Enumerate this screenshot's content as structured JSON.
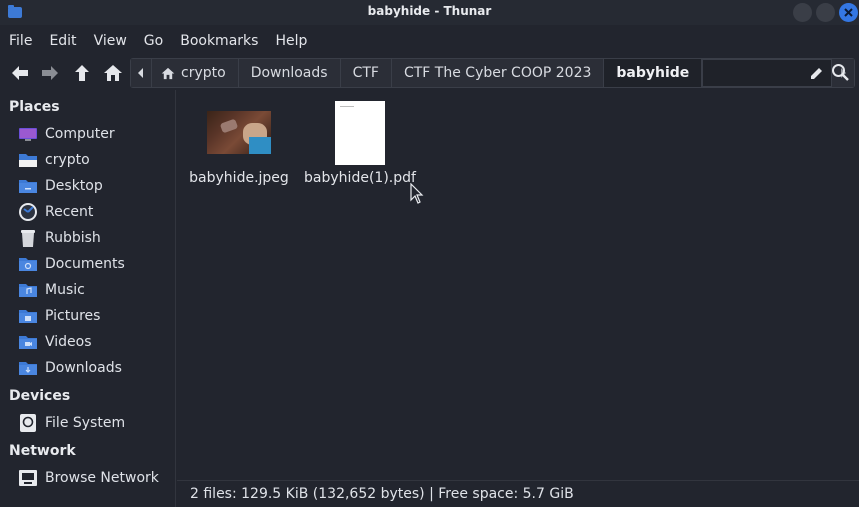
{
  "window": {
    "title": "babyhide - Thunar"
  },
  "menu": [
    "File",
    "Edit",
    "View",
    "Go",
    "Bookmarks",
    "Help"
  ],
  "breadcrumbs": [
    "crypto",
    "Downloads",
    "CTF",
    "CTF The Cyber COOP 2023",
    "babyhide"
  ],
  "sidebar": {
    "places_heading": "Places",
    "places": [
      {
        "label": "Computer",
        "icon": "computer-icon"
      },
      {
        "label": "crypto",
        "icon": "home-folder-icon"
      },
      {
        "label": "Desktop",
        "icon": "desktop-folder-icon"
      },
      {
        "label": "Recent",
        "icon": "recent-icon"
      },
      {
        "label": "Rubbish",
        "icon": "trash-icon"
      },
      {
        "label": "Documents",
        "icon": "documents-folder-icon"
      },
      {
        "label": "Music",
        "icon": "music-folder-icon"
      },
      {
        "label": "Pictures",
        "icon": "pictures-folder-icon"
      },
      {
        "label": "Videos",
        "icon": "videos-folder-icon"
      },
      {
        "label": "Downloads",
        "icon": "downloads-folder-icon"
      }
    ],
    "devices_heading": "Devices",
    "devices": [
      {
        "label": "File System",
        "icon": "drive-icon"
      }
    ],
    "network_heading": "Network",
    "network": [
      {
        "label": "Browse Network",
        "icon": "network-icon"
      }
    ]
  },
  "files": [
    {
      "name": "babyhide.jpeg",
      "type": "image"
    },
    {
      "name": "babyhide(1).pdf",
      "type": "pdf"
    }
  ],
  "status": {
    "text": "2 files: 129.5 KiB (132,652 bytes)  |  Free space: 5.7 GiB"
  },
  "colors": {
    "accent": "#3477e3",
    "folder": "#3d7ad6",
    "background": "#22252e"
  }
}
